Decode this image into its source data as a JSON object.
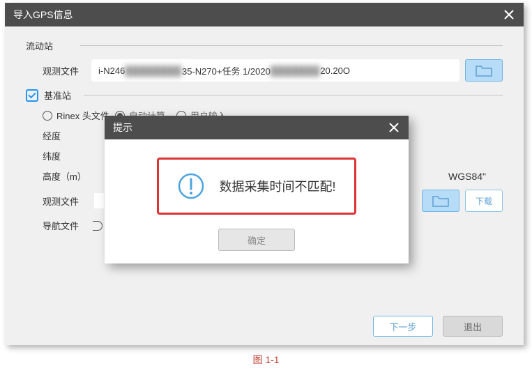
{
  "window": {
    "title": "导入GPS信息"
  },
  "rover": {
    "section": "流动站",
    "obs_label": "观测文件",
    "obs_value_a": "i-N246",
    "obs_value_b": "35-N270+任务 1/2020",
    "obs_value_c": "20.20O"
  },
  "base": {
    "section": "基准站",
    "rinex_label": "Rinex 头文件",
    "mode_auto": "自动计算",
    "mode_user": "用户输入",
    "lon_label": "经度",
    "lat_label": "纬度",
    "height_label": "高度（m）",
    "obs_label": "观测文件",
    "nav_label": "导航文件",
    "wgs": "WGS84\"",
    "download": "下载"
  },
  "buttons": {
    "next": "下一步",
    "exit": "退出"
  },
  "modal": {
    "title": "提示",
    "message": "数据采集时间不匹配!",
    "ok": "确定"
  },
  "caption": "图 1-1"
}
